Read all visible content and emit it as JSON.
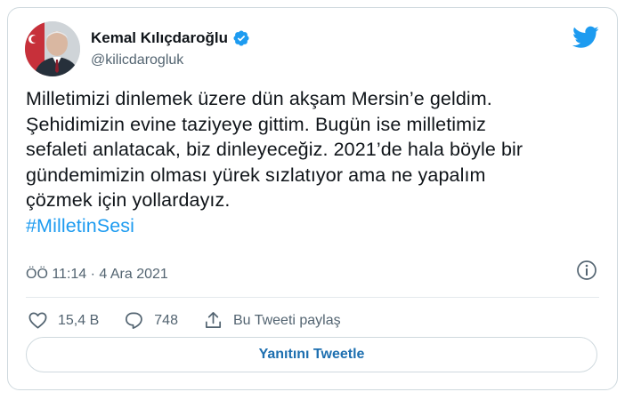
{
  "author": {
    "name": "Kemal Kılıçdaroğlu",
    "handle": "@kilicdarogluk"
  },
  "tweet": {
    "lines": [
      "Milletimizi dinlemek üzere dün akşam Mersin’e geldim.",
      "Şehidimizin evine taziyeye gittim. Bugün ise milletimiz",
      "sefaleti anlatacak, biz dinleyeceğiz. 2021’de hala böyle bir",
      "gündemimizin olması yürek sızlatıyor ama ne yapalım",
      "çözmek için yollardayız."
    ],
    "hashtag": "#MilletinSesi",
    "timestamp": "ÖÖ 11:14 · 4 Ara 2021"
  },
  "actions": {
    "likes": "15,4 B",
    "replies": "748",
    "share_label": "Bu Tweeti paylaş"
  },
  "reply_button_label": "Yanıtını Tweetle",
  "colors": {
    "accent": "#1d9bf0",
    "text": "#0f1419",
    "secondary": "#536471",
    "border": "#cfd9de"
  },
  "icons": {
    "brand": "twitter-bird-icon",
    "verified": "verified-badge-icon",
    "info": "info-icon",
    "like": "heart-icon",
    "reply": "speech-bubble-icon",
    "share": "share-upload-icon"
  }
}
